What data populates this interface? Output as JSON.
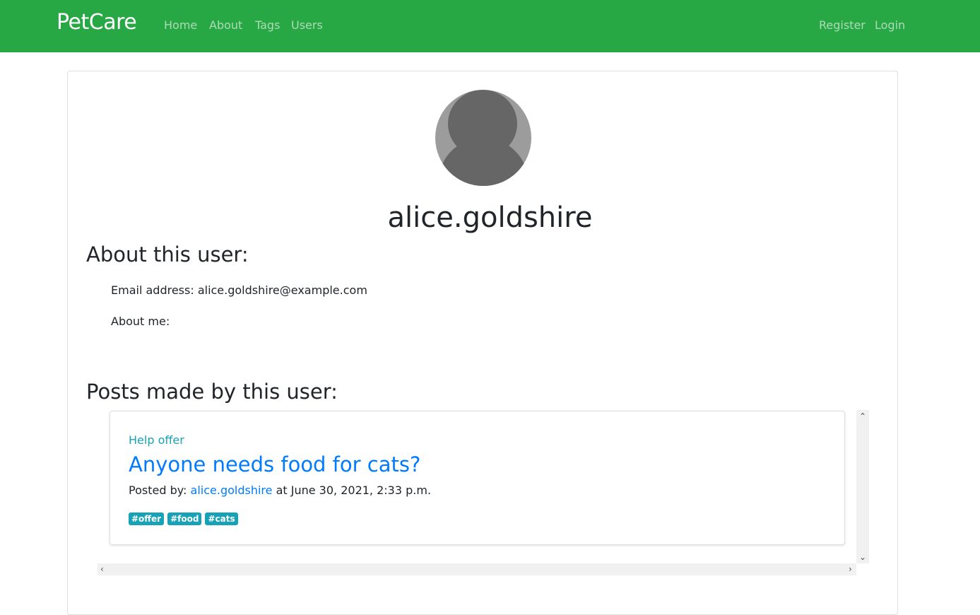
{
  "navbar": {
    "brand": "PetCare",
    "links": [
      "Home",
      "About",
      "Tags",
      "Users"
    ],
    "right_links": [
      "Register",
      "Login"
    ],
    "color": "#28a745"
  },
  "profile": {
    "username": "alice.goldshire",
    "about_heading": "About this user:",
    "email_line": "Email address: alice.goldshire@example.com",
    "about_me_line": "About me:",
    "posts_heading": "Posts made by this user:"
  },
  "posts": [
    {
      "category": "Help offer",
      "title": "Anyone needs food for cats?",
      "posted_by_prefix": "Posted by:",
      "author": "alice.goldshire",
      "date_text": "at June 30, 2021, 2:33 p.m.",
      "tags": [
        "#offer",
        "#food",
        "#cats"
      ]
    }
  ],
  "scrollbar_icons": {
    "up": "chevron-up-icon",
    "down": "chevron-down-icon",
    "left": "chevron-left-icon",
    "right": "chevron-right-icon"
  }
}
